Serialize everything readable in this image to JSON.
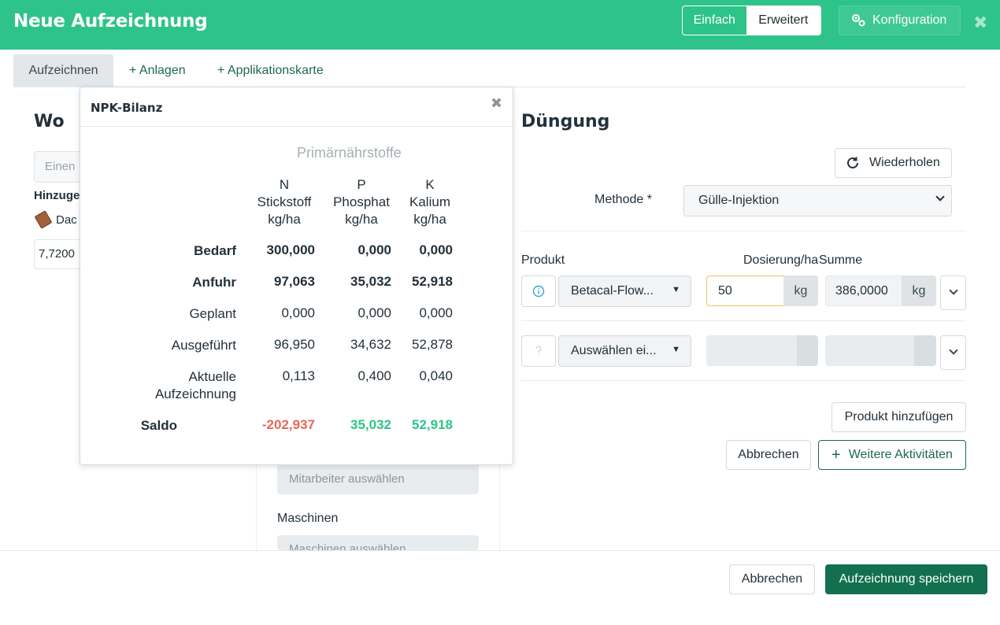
{
  "header": {
    "title": "Neue Aufzeichnung",
    "mode_simple": "Einfach",
    "mode_advanced": "Erweitert",
    "config_label": "Konfiguration",
    "close_icon": "close-icon"
  },
  "tabs": [
    {
      "label": "Aufzeichnen"
    },
    {
      "label": "+ Anlagen"
    },
    {
      "label": "+ Applikationskarte"
    }
  ],
  "left": {
    "title": "Wo",
    "search_placeholder": "Einen",
    "added_label": "Hinzuge",
    "field_name": "Dac",
    "area_value": "7,7200"
  },
  "middle": {
    "employee_placeholder": "Mitarbeiter auswählen",
    "machines_label": "Maschinen",
    "machines_placeholder": "Maschinen auswählen"
  },
  "duengung": {
    "title": "Düngung",
    "repeat_label": "Wiederholen",
    "method_label": "Methode *",
    "method_value": "Gülle-Injektion",
    "col_product": "Produkt",
    "col_dose": "Dosierung/ha",
    "col_sum": "Summe",
    "rows": [
      {
        "product": "Betacal-Flow...",
        "dose": "50",
        "dose_unit": "kg",
        "sum": "386,0000",
        "sum_unit": "kg"
      },
      {
        "product": "Auswählen ei...",
        "dose": "",
        "dose_unit": "",
        "sum": "",
        "sum_unit": ""
      }
    ],
    "add_product_label": "Produkt hinzufügen",
    "cancel_label": "Abbrechen",
    "more_activities_label": "Weitere Aktivitäten"
  },
  "footer": {
    "cancel_label": "Abbrechen",
    "save_label": "Aufzeichnung speichern"
  },
  "npk": {
    "title": "NPK-Bilanz",
    "group_label": "Primärnährstoffe",
    "columns": [
      {
        "symbol": "N",
        "name": "Stickstoff",
        "unit": "kg/ha"
      },
      {
        "symbol": "P",
        "name": "Phosphat",
        "unit": "kg/ha"
      },
      {
        "symbol": "K",
        "name": "Kalium",
        "unit": "kg/ha"
      }
    ],
    "rows": [
      {
        "label": "Bedarf",
        "values": [
          "300,000",
          "0,000",
          "0,000"
        ]
      },
      {
        "label": "Anfuhr",
        "values": [
          "97,063",
          "35,032",
          "52,918"
        ]
      },
      {
        "label": "Geplant",
        "values": [
          "0,000",
          "0,000",
          "0,000"
        ]
      },
      {
        "label": "Ausgeführt",
        "values": [
          "96,950",
          "34,632",
          "52,878"
        ]
      },
      {
        "label_line1": "Aktuelle",
        "label_line2": "Aufzeichnung",
        "values": [
          "0,113",
          "0,400",
          "0,040"
        ]
      },
      {
        "label": "Saldo",
        "values": [
          "-202,937",
          "35,032",
          "52,918"
        ]
      }
    ],
    "colors": {
      "negative": "#e8675a",
      "positive": "#2dc389"
    }
  },
  "colors": {
    "brand": "#2dc389",
    "primary_dark": "#13704f"
  }
}
